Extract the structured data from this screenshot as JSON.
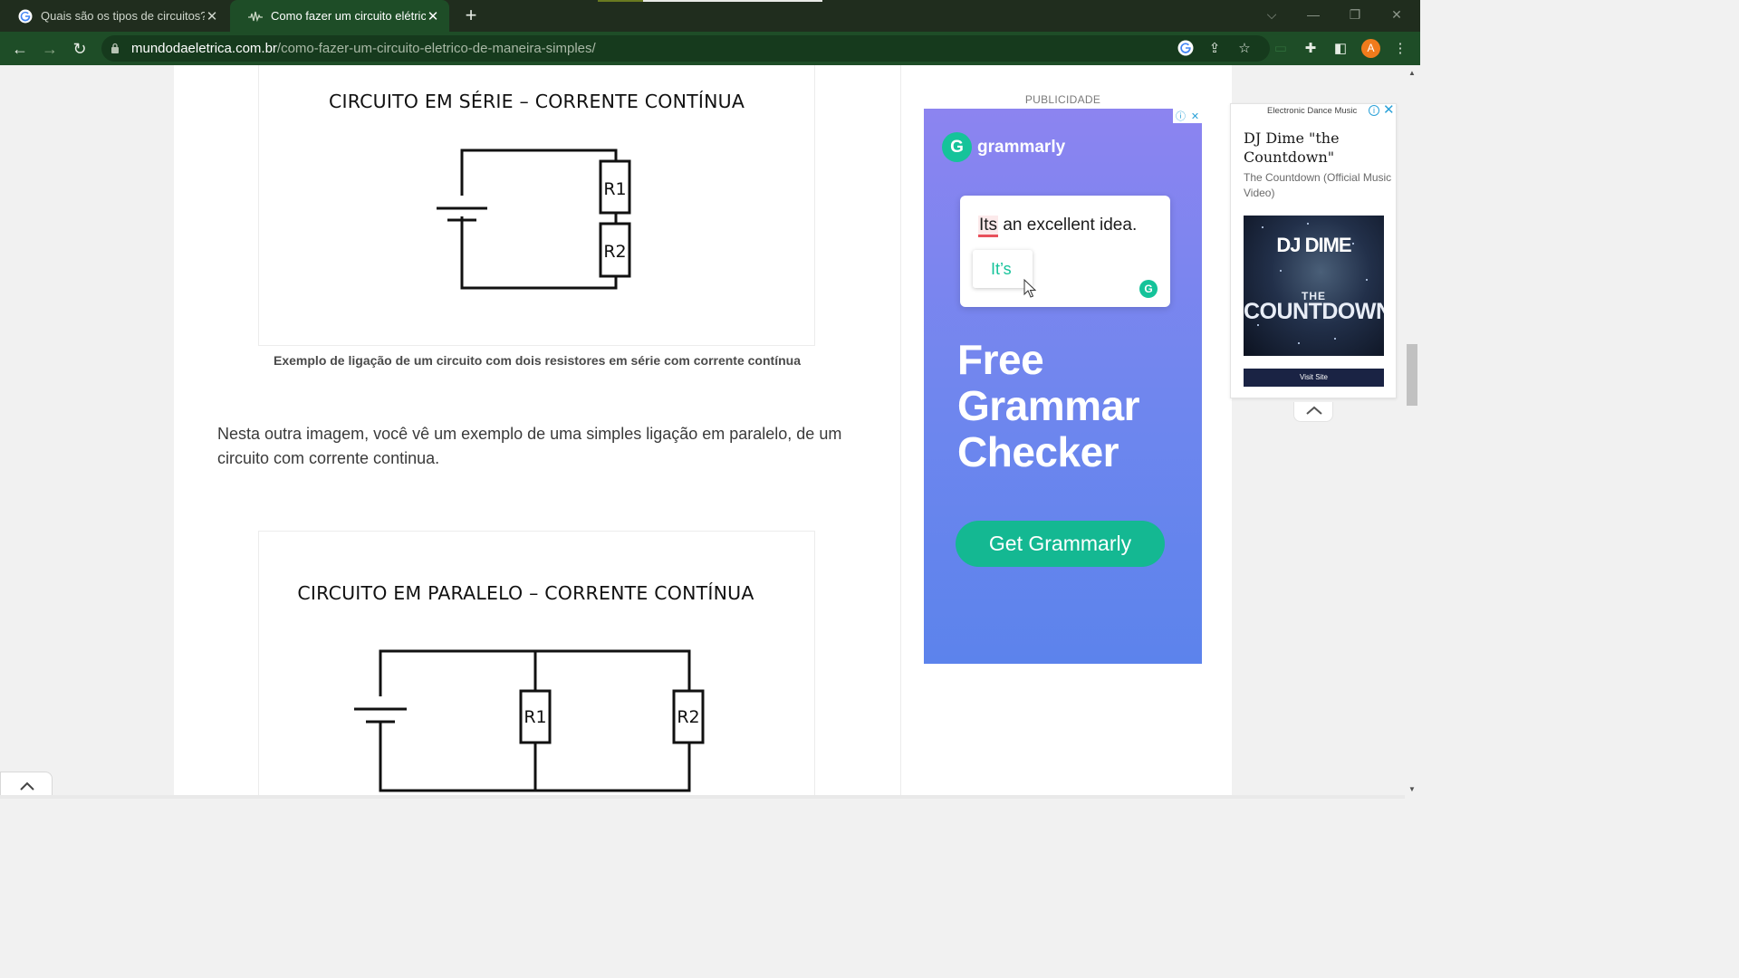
{
  "browser": {
    "tabs": [
      {
        "title": "Quais são os tipos de circuitos? -",
        "active": false
      },
      {
        "title": "Como fazer um circuito elétrico d",
        "active": true
      }
    ],
    "url_domain": "mundodaeletrica.com.br",
    "url_path": "/como-fazer-um-circuito-eletrico-de-maneira-simples/",
    "profile_initial": "A",
    "colors": {
      "tabbar": "#202d1e",
      "toolbar": "#1e4d27",
      "avatar": "#f07b1c"
    }
  },
  "article": {
    "figure1": {
      "title": "CIRCUITO EM SÉRIE – CORRENTE CONTÍNUA",
      "labels": [
        "R1",
        "R2"
      ]
    },
    "caption1": "Exemplo de ligação de um circuito com dois resistores em série com corrente contínua",
    "paragraph": "Nesta outra imagem, você vê um exemplo de uma simples ligação em paralelo, de um circuito com corrente continua.",
    "figure2": {
      "title": "CIRCUITO EM PARALELO – CORRENTE CONTÍNUA",
      "labels": [
        "R1",
        "R2"
      ]
    }
  },
  "sidebar": {
    "ad_label": "PUBLICIDADE",
    "grammarly_ad": {
      "brand": "grammarly",
      "brand_initial": "G",
      "example_error": "Its",
      "example_rest": " an excellent idea.",
      "suggestion": "It’s",
      "headline": "Free Grammar Checker",
      "cta": "Get Grammarly",
      "colors": {
        "accent": "#15c39a",
        "bg_top": "#8c84f0",
        "bg_bottom": "#5c83ec"
      }
    }
  },
  "video_ad": {
    "category": "Electronic Dance Music",
    "title": "DJ Dime \"the Countdown\"",
    "subtitle": "The Countdown (Official Music Video)",
    "thumb_line1": "DJ DIME",
    "thumb_line2": "THE",
    "thumb_line3": "COUNTDOWN",
    "button": "Visit Site"
  }
}
